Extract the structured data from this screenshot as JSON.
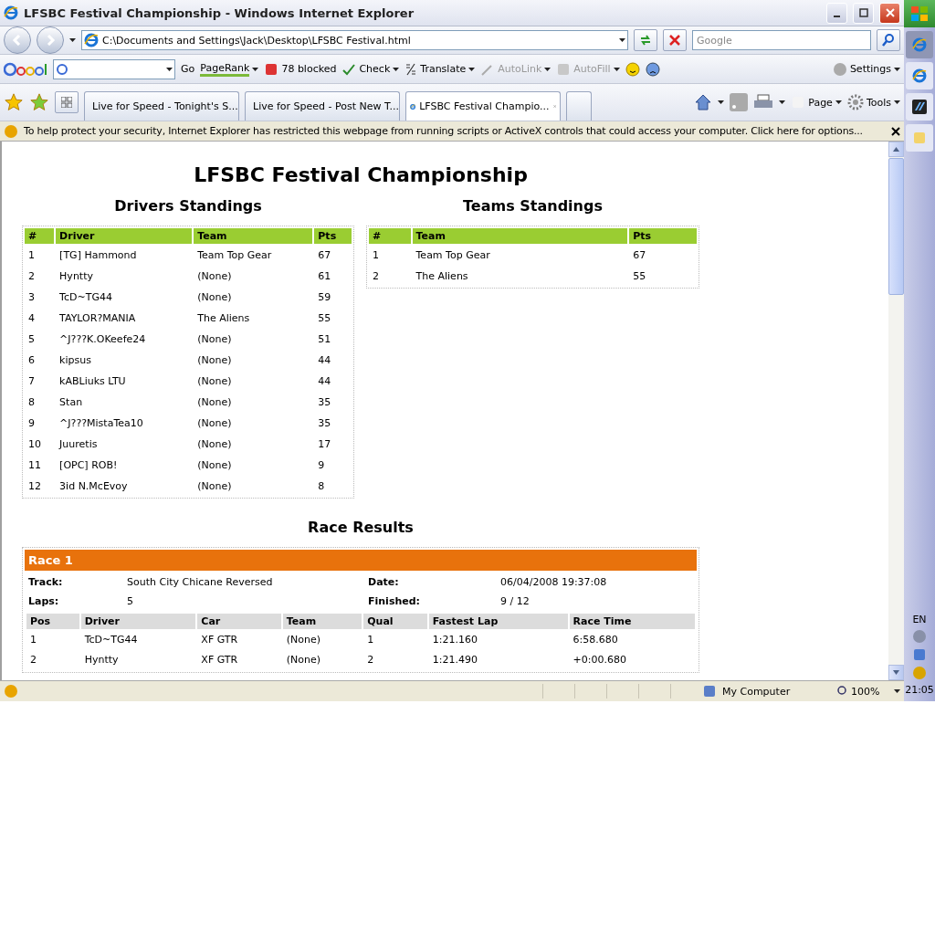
{
  "window": {
    "title": "LFSBC Festival Championship - Windows Internet Explorer"
  },
  "address_bar": {
    "url": "C:\\Documents and Settings\\Jack\\Desktop\\LFSBC Festival.html"
  },
  "search": {
    "placeholder": "Google"
  },
  "google_toolbar": {
    "items": [
      {
        "label": "Go",
        "kind": "text",
        "disabled": false
      },
      {
        "label": "PageRank",
        "kind": "pagerank",
        "disabled": false
      },
      {
        "label": "78 blocked",
        "kind": "blocked",
        "disabled": false
      },
      {
        "label": "Check",
        "kind": "check",
        "disabled": false
      },
      {
        "label": "Translate",
        "kind": "translate",
        "disabled": false
      },
      {
        "label": "AutoLink",
        "kind": "autolink",
        "disabled": true
      },
      {
        "label": "AutoFill",
        "kind": "autofill",
        "disabled": true
      }
    ],
    "settings": "Settings"
  },
  "tabs": [
    {
      "label": "Live for Speed - Tonight's S...",
      "selected": false
    },
    {
      "label": "Live for Speed - Post New T...",
      "selected": false
    },
    {
      "label": "LFSBC Festival Champio...",
      "selected": true
    }
  ],
  "command_bar": [
    "Page",
    "Tools"
  ],
  "info_bar": "To help protect your security, Internet Explorer has restricted this webpage from running scripts or ActiveX controls that could access your computer. Click here for options...",
  "page": {
    "title": "LFSBC Festival Championship",
    "drivers": {
      "heading": "Drivers Standings",
      "columns": [
        "#",
        "Driver",
        "Team",
        "Pts"
      ],
      "rows": [
        [
          "1",
          "[TG] Hammond",
          "Team Top Gear",
          "67"
        ],
        [
          "2",
          "Hyntty",
          "(None)",
          "61"
        ],
        [
          "3",
          "TcD~TG44",
          "(None)",
          "59"
        ],
        [
          "4",
          "TAYLOR?MANIA",
          "The Aliens",
          "55"
        ],
        [
          "5",
          "^J???K.OKeefe24",
          "(None)",
          "51"
        ],
        [
          "6",
          "kipsus",
          "(None)",
          "44"
        ],
        [
          "7",
          "kABLiuks LTU",
          "(None)",
          "44"
        ],
        [
          "8",
          "Stan",
          "(None)",
          "35"
        ],
        [
          "9",
          "^J???MistaTea10",
          "(None)",
          "35"
        ],
        [
          "10",
          "Juuretis",
          "(None)",
          "17"
        ],
        [
          "11",
          "[OPC] ROB!",
          "(None)",
          "9"
        ],
        [
          "12",
          "3id N.McEvoy",
          "(None)",
          "8"
        ]
      ]
    },
    "teams": {
      "heading": "Teams Standings",
      "columns": [
        "#",
        "Team",
        "Pts"
      ],
      "rows": [
        [
          "1",
          "Team Top Gear",
          "67"
        ],
        [
          "2",
          "The Aliens",
          "55"
        ]
      ]
    },
    "race_results": {
      "heading": "Race Results",
      "races": [
        {
          "name": "Race 1",
          "fields": [
            {
              "label": "Track:",
              "value": "South City Chicane Reversed"
            },
            {
              "label": "Date:",
              "value": "06/04/2008 19:37:08"
            },
            {
              "label": "Laps:",
              "value": "5"
            },
            {
              "label": "Finished:",
              "value": "9 / 12"
            }
          ],
          "columns": [
            "Pos",
            "Driver",
            "Car",
            "Team",
            "Qual",
            "Fastest Lap",
            "Race Time"
          ],
          "rows": [
            [
              "1",
              "TcD~TG44",
              "XF GTR",
              "(None)",
              "1",
              "1:21.160",
              "6:58.680"
            ],
            [
              "2",
              "Hyntty",
              "XF GTR",
              "(None)",
              "2",
              "1:21.490",
              "+0:00.680"
            ]
          ]
        }
      ]
    }
  },
  "status_bar": {
    "zone": "My Computer",
    "zoom": "100%"
  },
  "taskbar": {
    "language": "EN",
    "clock": "21:05"
  }
}
